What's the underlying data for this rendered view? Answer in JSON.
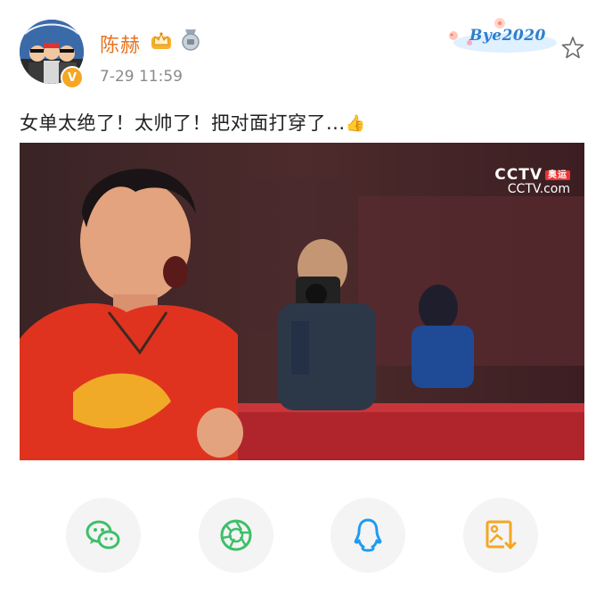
{
  "author": {
    "name": "陈赫",
    "avatar_icon": "avatar-group-photo",
    "verified_icon": "verified-v-badge",
    "verified_mark": "V",
    "badges": [
      "crown-badge-icon",
      "medal-badge-icon"
    ],
    "timestamp": "7-29 11:59",
    "pendant_text": "Bye2020"
  },
  "post": {
    "text": "女单太绝了！太帅了！把对面打穿了...",
    "emoji": "👍"
  },
  "media": {
    "type": "video-frame",
    "watermark_line1": "CCTV",
    "watermark_tag": "奥运",
    "watermark_line2": "CCTV.com"
  },
  "share": [
    {
      "name": "wechat",
      "icon": "wechat-icon",
      "color": "#3dbf6a"
    },
    {
      "name": "moments",
      "icon": "moments-shutter-icon",
      "color": "#3dbf6a"
    },
    {
      "name": "qq",
      "icon": "qq-penguin-icon",
      "color": "#1e9bf0"
    },
    {
      "name": "save-image",
      "icon": "save-image-icon",
      "color": "#f5a623"
    }
  ],
  "colors": {
    "username": "#e8731f",
    "timestamp": "#8a8a8a",
    "share_bg": "#f4f4f4"
  }
}
